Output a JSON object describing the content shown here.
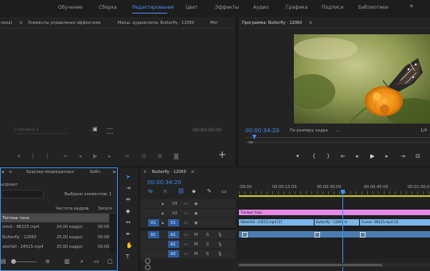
{
  "topbar": {
    "workspaces": [
      "Обучение",
      "Сборка",
      "Редактирование",
      "Цвет",
      "Эффекты",
      "Аудио",
      "Графика",
      "Подписи",
      "Библиотеки"
    ],
    "active": "Редактирование",
    "more": "»"
  },
  "source": {
    "tab_cut": "пека)",
    "tab_controls": "Элементы управления эффектами",
    "tab_mixer": "Микш. аудиоклипа: Butterfly - 12060",
    "tab_more": "Мет",
    "page_label": "Страница 1",
    "timecode": "00:00:00:00"
  },
  "program": {
    "title": "Программа: Butterfly - 12060",
    "menu": "≡",
    "timecode": "00:00:34:20",
    "fit": "По размеру кадра",
    "ratio": "1/4",
    "fraction": "1/4",
    "playhead_fraction": 0.05
  },
  "project": {
    "tab_cut": "а",
    "tab_browser": "Браузер медиаданных",
    "tab_more": "Библ",
    "project_name": "ьпроект",
    "selected": "Выбрано элементов: 1",
    "col_rate": "Частота кадров",
    "col_start": "Запуск",
    "rows": [
      {
        "name": "Теплые тона",
        "rate": "",
        "start": "",
        "color": "#c64bd6"
      },
      {
        "name": "orest - 86225.mp4",
        "rate": "24,00 кадр/с",
        "start": "00:00",
        "color": ""
      },
      {
        "name": "Butterfly - 12060",
        "rate": "25,00 кадр/с",
        "start": "00:00",
        "color": ""
      },
      {
        "name": "aterfall - 24515.mp4",
        "rate": "25,00 кадр/с",
        "start": "00:00",
        "color": ""
      }
    ]
  },
  "timeline": {
    "title": "Butterfly - 12060",
    "timecode": "00:00:34:20",
    "ruler": [
      ":00:00",
      "00:00:15:00",
      "00:00:30:00",
      "00:00:45:00",
      "00:01:00:0"
    ],
    "video_tracks": [
      "V3",
      "V2",
      "V1"
    ],
    "audio_tracks": [
      "A1",
      "A2",
      "A3"
    ],
    "src_v": "V1",
    "src_a": "A1",
    "adj_clip": "Теплые тона",
    "clips": {
      "waterfall": "Waterfall - 24515.mp4 [V]",
      "butterfly": "Butterfly - 12060.m",
      "forest": "Forest - 86225.mp4 [V]"
    }
  },
  "colors": {
    "accent": "#3d8ef0",
    "clip_video": "#7ab6e8",
    "clip_adj": "#e48ae6",
    "timecode": "#3d8ef0"
  }
}
